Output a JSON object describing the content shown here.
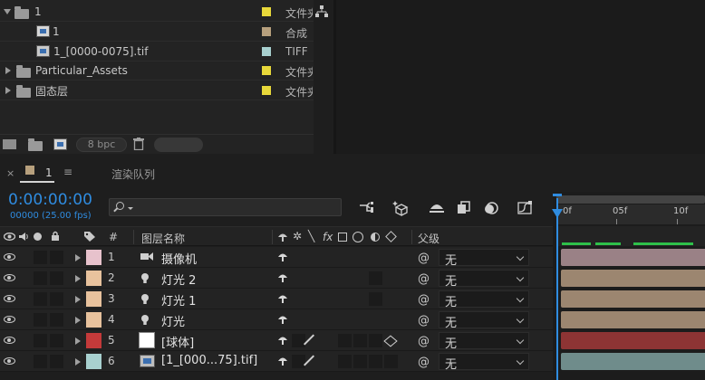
{
  "project": {
    "items": [
      {
        "name": "1",
        "type": "文件夹",
        "swatch": "#e8d83a",
        "expanded": true,
        "icon": "folder-icon"
      },
      {
        "name": "1",
        "type": "合成",
        "swatch": "#b7a07d",
        "icon": "composition-icon"
      },
      {
        "name": "1_[0000-0075].tif",
        "type": "TIFF",
        "swatch": "#a8d0cf",
        "icon": "image-sequence-icon"
      },
      {
        "name": "Particular_Assets",
        "type": "文件夹",
        "swatch": "#e8d83a",
        "expanded": false,
        "icon": "folder-icon"
      },
      {
        "name": "固态层",
        "type": "文件夹",
        "swatch": "#e8d83a",
        "expanded": false,
        "icon": "folder-icon"
      }
    ],
    "bit_depth": "8 bpc"
  },
  "timeline": {
    "tab_close": "×",
    "tab_name": "1",
    "tab_menu": "≡",
    "render_queue_label": "渲染队列",
    "timecode": "0:00:00:00",
    "frames_fps": "00000 (25.00 fps)",
    "ruler_labels": [
      "0f",
      "05f",
      "10f"
    ],
    "header": {
      "number": "#",
      "layer_name": "图层名称",
      "parent": "父级",
      "fx": "fx"
    },
    "layers": [
      {
        "num": "1",
        "name": "摄像机",
        "color": "#e7c2cc",
        "type": "camera-icon",
        "parent": "无",
        "bar": "#9a8186"
      },
      {
        "num": "2",
        "name": "灯光 2",
        "color": "#e8c29d",
        "type": "light-icon",
        "parent": "无",
        "bar": "#9c8670"
      },
      {
        "num": "3",
        "name": "灯光 1",
        "color": "#e8c29d",
        "type": "light-icon",
        "parent": "无",
        "bar": "#9c8670"
      },
      {
        "num": "4",
        "name": "灯光",
        "color": "#e8c29d",
        "type": "light-icon",
        "parent": "无",
        "bar": "#9c8670"
      },
      {
        "num": "5",
        "name": "[球体]",
        "color": "#c43a3a",
        "type": "solid-icon",
        "parent": "无",
        "bar": "#8d3434"
      },
      {
        "num": "6",
        "name": "[1_[000...75].tif]",
        "color": "#a8d0cf",
        "type": "image-sequence-icon",
        "parent": "无",
        "bar": "#6f8c8b"
      }
    ]
  }
}
